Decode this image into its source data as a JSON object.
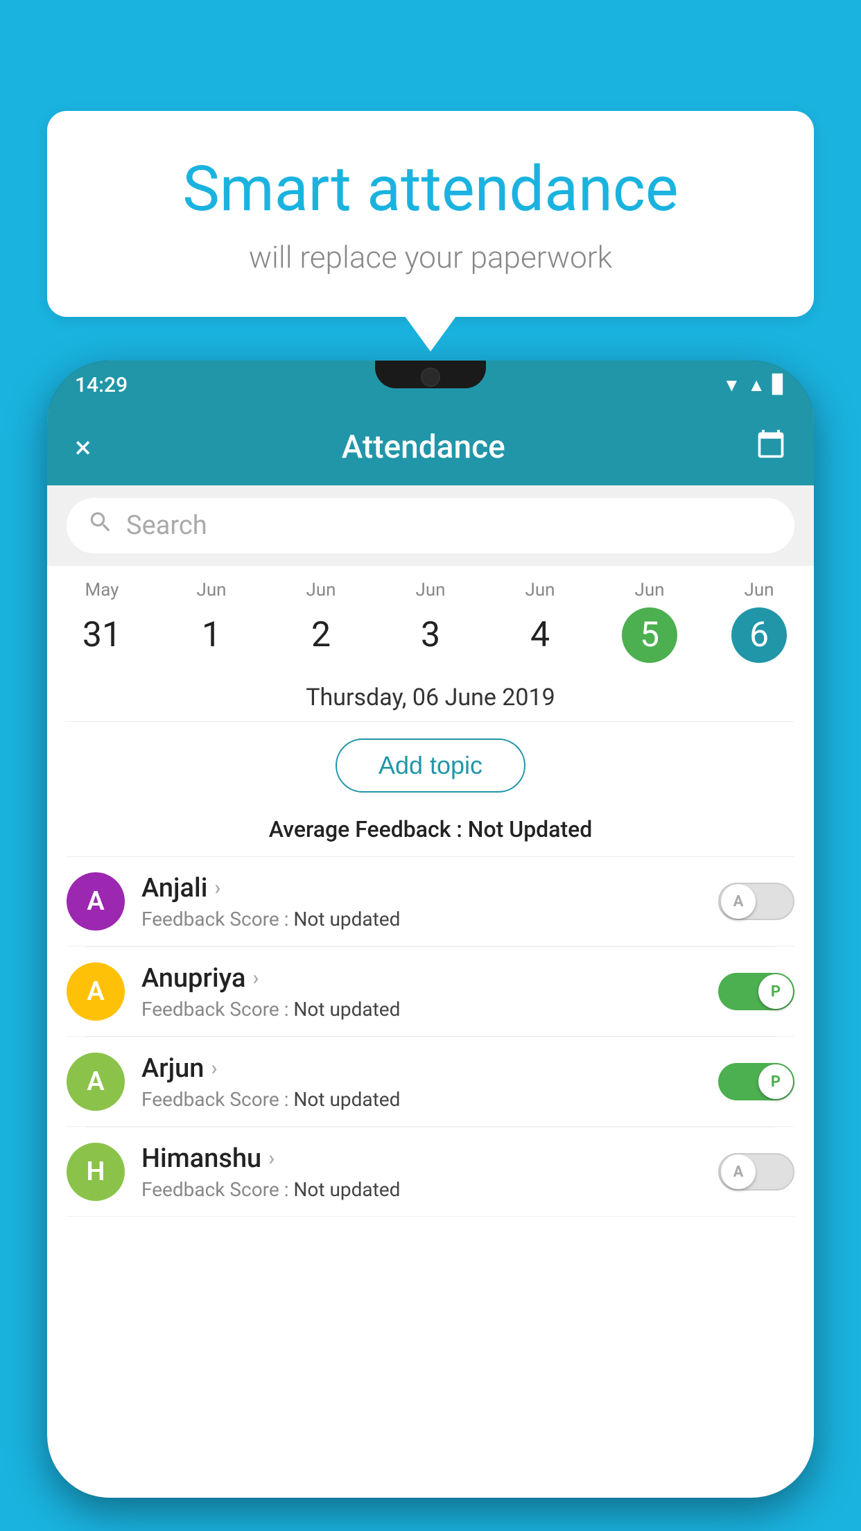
{
  "background_color": "#1ab3e0",
  "bubble": {
    "title": "Smart attendance",
    "subtitle": "will replace your paperwork"
  },
  "status_bar": {
    "time": "14:29",
    "icons": [
      "wifi",
      "signal",
      "battery"
    ]
  },
  "app_bar": {
    "close_label": "×",
    "title": "Attendance",
    "calendar_icon": "📅"
  },
  "search": {
    "placeholder": "Search"
  },
  "calendar": {
    "days": [
      {
        "month": "May",
        "date": "31",
        "state": "normal"
      },
      {
        "month": "Jun",
        "date": "1",
        "state": "normal"
      },
      {
        "month": "Jun",
        "date": "2",
        "state": "normal"
      },
      {
        "month": "Jun",
        "date": "3",
        "state": "normal"
      },
      {
        "month": "Jun",
        "date": "4",
        "state": "normal"
      },
      {
        "month": "Jun",
        "date": "5",
        "state": "today"
      },
      {
        "month": "Jun",
        "date": "6",
        "state": "selected"
      }
    ]
  },
  "selected_date": "Thursday, 06 June 2019",
  "add_topic_label": "Add topic",
  "average_feedback": {
    "label": "Average Feedback : ",
    "value": "Not Updated"
  },
  "students": [
    {
      "name": "Anjali",
      "avatar_letter": "A",
      "avatar_color": "#9c27b0",
      "feedback": "Not updated",
      "toggle_state": "off",
      "toggle_letter": "A"
    },
    {
      "name": "Anupriya",
      "avatar_letter": "A",
      "avatar_color": "#ffc107",
      "feedback": "Not updated",
      "toggle_state": "on",
      "toggle_letter": "P"
    },
    {
      "name": "Arjun",
      "avatar_letter": "A",
      "avatar_color": "#8bc34a",
      "feedback": "Not updated",
      "toggle_state": "on",
      "toggle_letter": "P"
    },
    {
      "name": "Himanshu",
      "avatar_letter": "H",
      "avatar_color": "#8bc34a",
      "feedback": "Not updated",
      "toggle_state": "off",
      "toggle_letter": "A"
    }
  ]
}
